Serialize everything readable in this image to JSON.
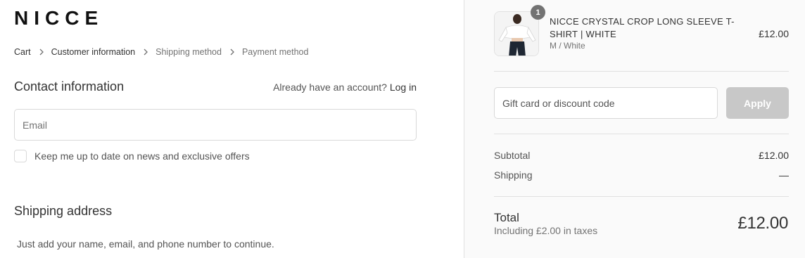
{
  "brand": {
    "logo_text": "NICCE"
  },
  "breadcrumb": {
    "items": [
      {
        "label": "Cart"
      },
      {
        "label": "Customer information"
      },
      {
        "label": "Shipping method"
      },
      {
        "label": "Payment method"
      }
    ]
  },
  "contact": {
    "title": "Contact information",
    "account_prompt": "Already have an account?",
    "login_label": "Log in",
    "email_placeholder": "Email",
    "email_value": "",
    "newsletter_label": "Keep me up to date on news and exclusive offers",
    "newsletter_checked": false
  },
  "shipping": {
    "title": "Shipping address",
    "helper_text": "Just add your name, email, and phone number to continue."
  },
  "order_summary": {
    "product": {
      "name": "NICCE CRYSTAL CROP LONG SLEEVE T-SHIRT | WHITE",
      "variant": "M / White",
      "price": "£12.00",
      "quantity": "1",
      "image_icon": "product-thumbnail"
    },
    "discount": {
      "placeholder": "Gift card or discount code",
      "value": "",
      "apply_label": "Apply"
    },
    "subtotal_label": "Subtotal",
    "subtotal_value": "£12.00",
    "shipping_label": "Shipping",
    "shipping_value": "—",
    "total_label": "Total",
    "tax_note": "Including £2.00 in taxes",
    "total_value": "£12.00"
  },
  "colors": {
    "sidebar_bg": "#fafafa",
    "apply_button_disabled": "#c8c8c8",
    "badge": "#737373",
    "text": "#333333",
    "muted_text": "#737373"
  }
}
